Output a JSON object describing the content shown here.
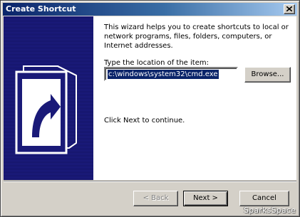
{
  "window": {
    "title": "Create Shortcut"
  },
  "main": {
    "description": "This wizard helps you to create shortcuts to local or network programs, files, folders, computers, or Internet addresses.",
    "location_label": "Type the location of the item:",
    "location_value": "c:\\windows\\system32\\cmd.exe",
    "browse_label": "Browse...",
    "next_hint": "Click Next to continue."
  },
  "footer": {
    "back_label": "< Back",
    "next_label": "Next >",
    "cancel_label": "Cancel"
  },
  "watermark": "SparksSpace",
  "icons": {
    "close": "close-icon",
    "wizard": "shortcut-arrow-icon"
  },
  "colors": {
    "titlebar_start": "#0a246a",
    "titlebar_end": "#a6caf0",
    "side_panel": "#151570",
    "selection": "#0a246a"
  }
}
